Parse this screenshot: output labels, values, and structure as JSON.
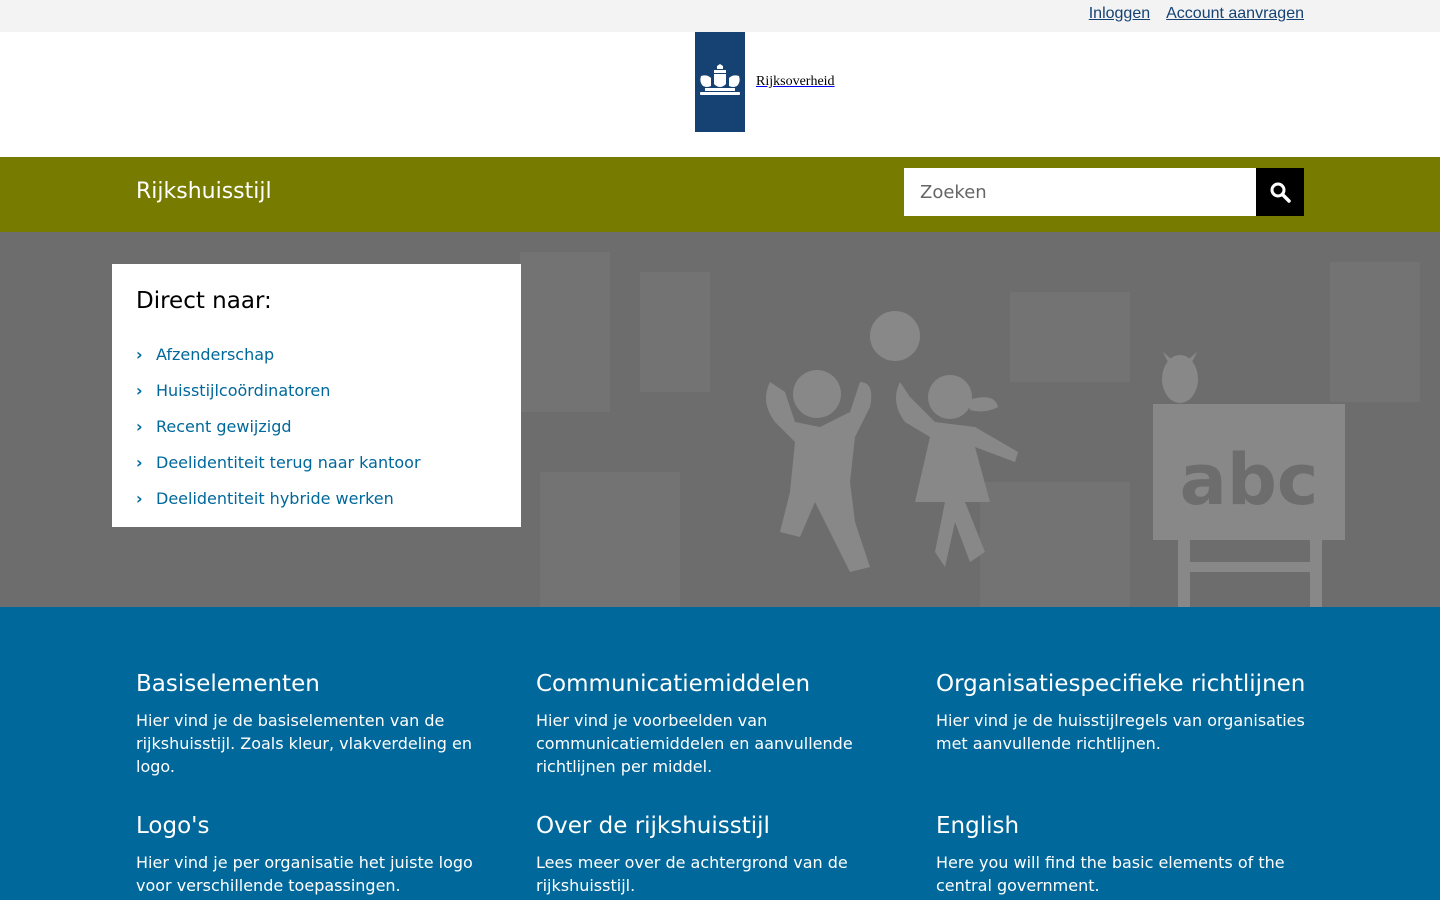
{
  "topbar": {
    "login": "Inloggen",
    "register": "Account aanvragen"
  },
  "logo": {
    "wordmark": "Rijksoverheid",
    "ribbon_color": "#154273"
  },
  "brandbar": {
    "title": "Rijkshuisstijl",
    "color": "#777c00",
    "search_placeholder": "Zoeken",
    "search_icon": "search-icon"
  },
  "quicklinks": {
    "heading": "Direct naar:",
    "items": [
      "Afzenderschap",
      "Huisstijlcoördinatoren",
      "Recent gewijzigd",
      "Deelidentiteit terug naar kantoor",
      "Deelidentiteit hybride werken"
    ]
  },
  "hero": {
    "illustration_text": "abc"
  },
  "tiles": [
    {
      "title": "Basiselementen",
      "text": "Hier vind je de basiselementen van de rijkshuisstijl. Zoals kleur, vlakverdeling en logo."
    },
    {
      "title": "Communicatiemiddelen",
      "text": "Hier vind je voorbeelden van communicatiemiddelen en aanvullende richtlijnen per middel."
    },
    {
      "title": "Organisatiespecifieke richtlijnen",
      "text": "Hier vind je de huisstijlregels van organisaties met aanvullende richtlijnen."
    },
    {
      "title": "Logo's",
      "text": "Hier vind je per organisatie het juiste logo voor verschillende toepassingen."
    },
    {
      "title": "Over de rijkshuisstijl",
      "text": "Lees meer over de achtergrond van de rijkshuisstijl."
    },
    {
      "title": "English",
      "text": "Here you will find the basic elements of the central government."
    }
  ],
  "colors": {
    "link": "#01689b",
    "tiles_bg": "#01689b",
    "hero_bg": "#6d6d6d"
  }
}
